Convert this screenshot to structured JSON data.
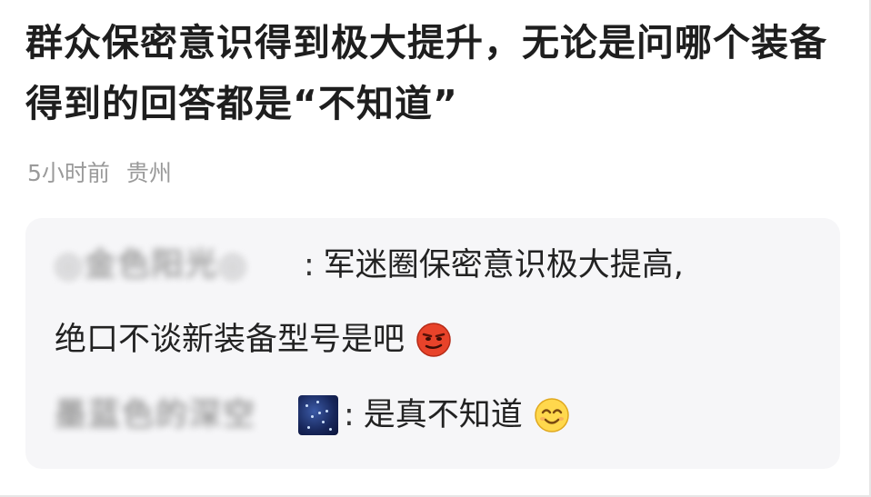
{
  "post": {
    "title": "群众保密意识得到极大提升，无论是问哪个装备得到的回答都是“不知道”",
    "time_ago": "5小时前",
    "location": "贵州"
  },
  "comments": [
    {
      "username": "◎金色阳光◎",
      "colon": ":",
      "text_line1": "军迷圈保密意识极大提高,",
      "text_line2": "绝口不谈新装备型号是吧",
      "emoji": "smirk-emoji"
    },
    {
      "username": "墨蓝色的深空",
      "colon": ":",
      "text": "是真不知道",
      "emoji": "smile-emoji",
      "avatar": "starry-sky-avatar"
    }
  ],
  "colors": {
    "comment_bg": "#f6f6f8",
    "meta_text": "#9a9a9a",
    "emoji_red": "#e8432a",
    "emoji_yellow": "#ffd84d"
  }
}
